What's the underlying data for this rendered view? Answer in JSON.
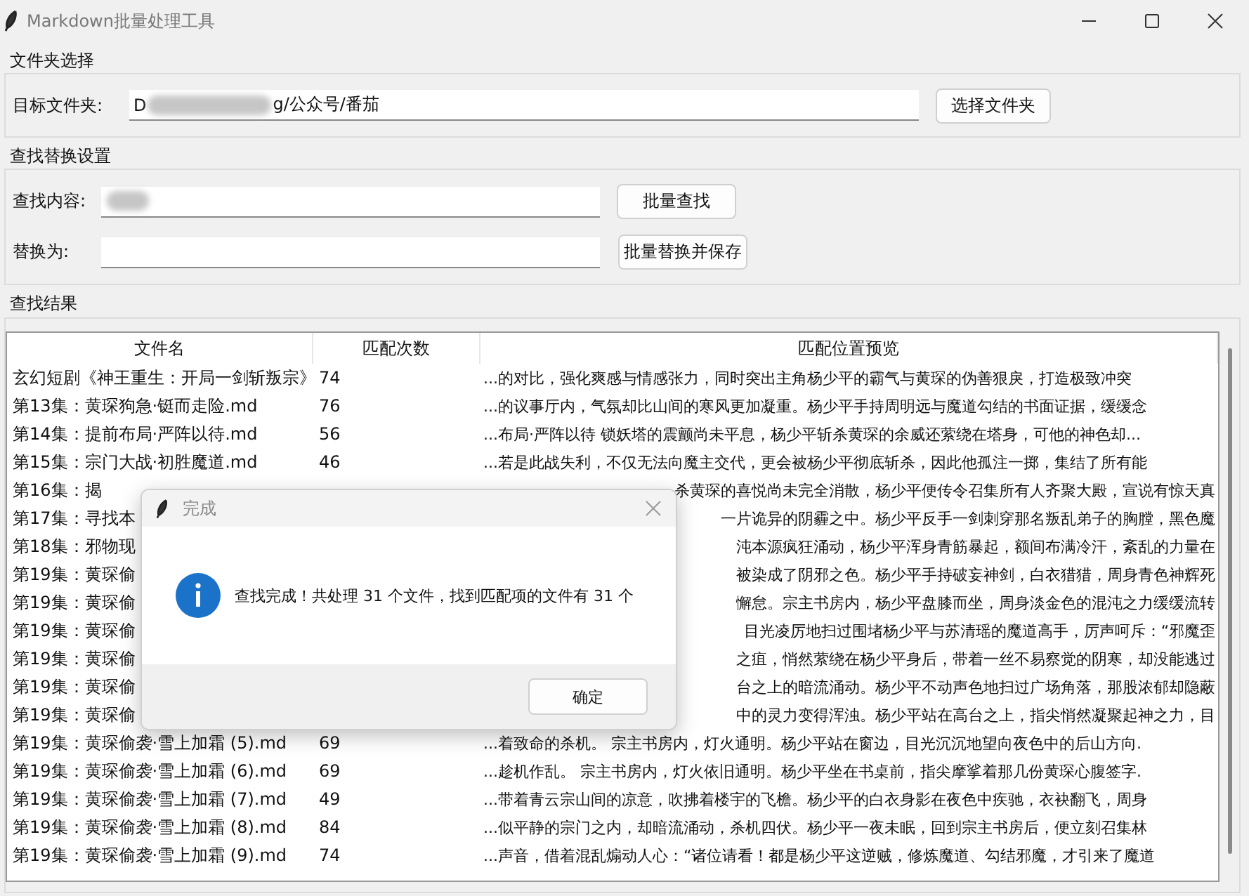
{
  "window": {
    "title": "Markdown批量处理工具"
  },
  "folder_group": {
    "title": "文件夹选择",
    "label": "目标文件夹:",
    "value_start": "D",
    "value_end": "g/公众号/番茄",
    "button": "选择文件夹"
  },
  "replace_group": {
    "title": "查找替换设置",
    "find_label": "查找内容:",
    "replace_label": "替换为:",
    "find_button": "批量查找",
    "replace_button": "批量替换并保存"
  },
  "results": {
    "title": "查找结果",
    "columns": [
      "文件名",
      "匹配次数",
      "匹配位置预览"
    ],
    "rows": [
      {
        "name": "玄幻短剧《神王重生：开局一剑斩叛宗》",
        "count": "74",
        "preview": "...的对比，强化爽感与情感张力，同时突出主角杨少平的霸气与黄琛的伪善狠戾，打造极致冲突"
      },
      {
        "name": "第13集：黄琛狗急·铤而走险.md",
        "count": "76",
        "preview": "...的议事厅内，气氛却比山间的寒风更加凝重。杨少平手持周明远与魔道勾结的书面证据，缓缓念"
      },
      {
        "name": "第14集：提前布局·严阵以待.md",
        "count": "56",
        "preview": "...布局·严阵以待  锁妖塔的震颤尚未平息，杨少平斩杀黄琛的余威还萦绕在塔身，可他的神色却..."
      },
      {
        "name": "第15集：宗门大战·初胜魔道.md",
        "count": "46",
        "preview": "...若是此战失利，不仅无法向魔主交代，更会被杨少平彻底斩杀，因此他孤注一掷，集结了所有能"
      },
      {
        "name": "第16集：揭",
        "preview": "杀黄琛的喜悦尚未完全消散，杨少平便传令召集所有人齐聚大殿，宣说有惊天真"
      },
      {
        "name": "第17集：寻找本",
        "preview": "一片诡异的阴霾之中。杨少平反手一剑刺穿那名叛乱弟子的胸膛，黑色魔"
      },
      {
        "name": "第18集：邪物现",
        "preview": "沌本源疯狂涌动，杨少平浑身青筋暴起，额间布满冷汗，紊乱的力量在"
      },
      {
        "name": "第19集：黄琛偷",
        "preview": "被染成了阴邪之色。杨少平手持破妄神剑，白衣猎猎，周身青色神辉死"
      },
      {
        "name": "第19集：黄琛偷",
        "preview": "懈怠。宗主书房内，杨少平盘膝而坐，周身淡金色的混沌之力缓缓流转"
      },
      {
        "name": "第19集：黄琛偷",
        "preview": "目光凌厉地扫过围堵杨少平与苏清瑶的魔道高手，厉声呵斥：“邪魔歪"
      },
      {
        "name": "第19集：黄琛偷",
        "preview": "之疽，悄然萦绕在杨少平身后，带着一丝不易察觉的阴寒，却没能逃过"
      },
      {
        "name": "第19集：黄琛偷",
        "preview": "台之上的暗流涌动。杨少平不动声色地扫过广场角落，那股浓郁却隐蔽"
      },
      {
        "name": "第19集：黄琛偷",
        "preview": "中的灵力变得浑浊。杨少平站在高台之上，指尖悄然凝聚起神之力，目"
      },
      {
        "name": "第19集：黄琛偷袭·雪上加霜 (5).md",
        "count": "69",
        "preview": "...着致命的杀机。   宗主书房内，灯火通明。杨少平站在窗边，目光沉沉地望向夜色中的后山方向."
      },
      {
        "name": "第19集：黄琛偷袭·雪上加霜 (6).md",
        "count": "69",
        "preview": "...趁机作乱。   宗主书房内，灯火依旧通明。杨少平坐在书桌前，指尖摩挲着那几份黄琛心腹签字."
      },
      {
        "name": "第19集：黄琛偷袭·雪上加霜 (7).md",
        "count": "49",
        "preview": "...带着青云宗山间的凉意，吹拂着楼宇的飞檐。杨少平的白衣身影在夜色中疾驰，衣袂翻飞，周身"
      },
      {
        "name": "第19集：黄琛偷袭·雪上加霜 (8).md",
        "count": "84",
        "preview": "...似平静的宗门之内，却暗流涌动，杀机四伏。杨少平一夜未眠，回到宗主书房后，便立刻召集林"
      },
      {
        "name": "第19集：黄琛偷袭·雪上加霜 (9).md",
        "count": "74",
        "preview": "...声音，借着混乱煽动人心：“诸位请看！都是杨少平这逆贼，修炼魔道、勾结邪魔，才引来了魔道"
      }
    ]
  },
  "dialog": {
    "title": "完成",
    "message": "查找完成！共处理 31 个文件，找到匹配项的文件有 31 个",
    "button": "确定"
  }
}
